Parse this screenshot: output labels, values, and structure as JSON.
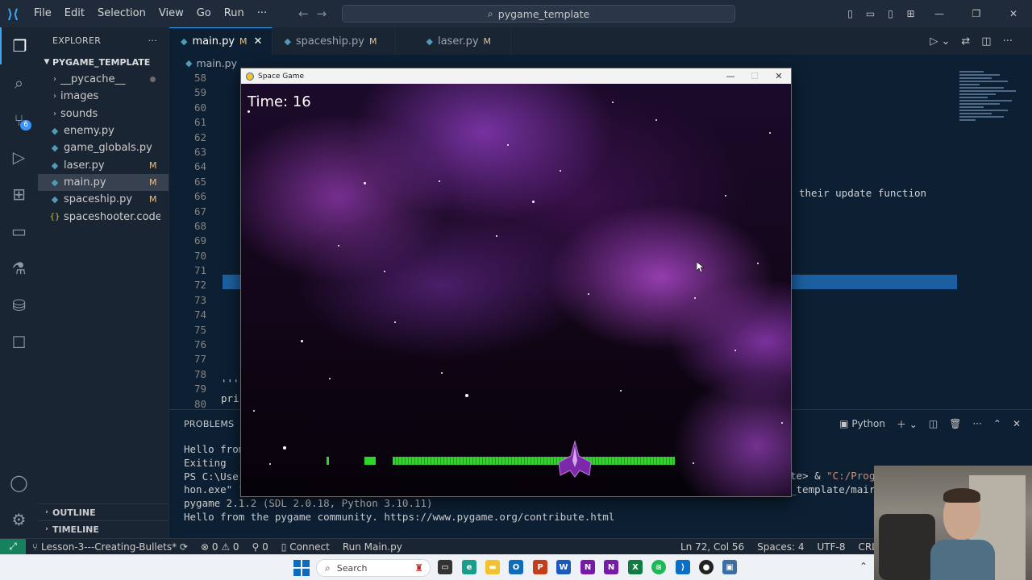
{
  "titlebar": {
    "menu": [
      "File",
      "Edit",
      "Selection",
      "View",
      "Go",
      "Run",
      "···"
    ],
    "search_text": "pygame_template"
  },
  "activity": {
    "scm_badge": "6"
  },
  "sidebar": {
    "header": "EXPLORER",
    "header_more": "···",
    "project": "PYGAME_TEMPLATE",
    "items": [
      {
        "label": "__pycache__",
        "type": "folder",
        "mod": ""
      },
      {
        "label": "images",
        "type": "folder",
        "mod": ""
      },
      {
        "label": "sounds",
        "type": "folder",
        "mod": ""
      },
      {
        "label": "enemy.py",
        "type": "python",
        "mod": ""
      },
      {
        "label": "game_globals.py",
        "type": "python",
        "mod": ""
      },
      {
        "label": "laser.py",
        "type": "python",
        "mod": "M"
      },
      {
        "label": "main.py",
        "type": "python",
        "mod": "M"
      },
      {
        "label": "spaceship.py",
        "type": "python",
        "mod": "M"
      },
      {
        "label": "spaceshooter.code-w...",
        "type": "json",
        "mod": ""
      }
    ],
    "outline": "OUTLINE",
    "timeline": "TIMELINE"
  },
  "tabs": [
    {
      "label": "main.py",
      "mod": "M",
      "active": true
    },
    {
      "label": "spaceship.py",
      "mod": "M",
      "active": false
    },
    {
      "label": "laser.py",
      "mod": "M",
      "active": false
    }
  ],
  "breadcrumb": "main.py",
  "editor": {
    "line_numbers": [
      "58",
      "59",
      "60",
      "61",
      "62",
      "63",
      "64",
      "65",
      "66",
      "67",
      "68",
      "69",
      "70",
      "71",
      "72",
      "73",
      "74",
      "75",
      "76",
      "77",
      "78",
      "79",
      "80"
    ],
    "comment_fragment": "their update function",
    "line79_fragment": "'''",
    "line80_fragment": "pri"
  },
  "panel": {
    "tab_problems": "PROBLEMS",
    "shell_label": "Python",
    "terminal_lines": [
      "Hello from",
      "Exiting",
      "PS C:\\User",
      "hon.exe\" \"",
      "pygame 2.1.2 (SDL 2.0.18, Python 3.10.11)",
      "Hello from the pygame community. https://www.pygame.org/contribute.html"
    ],
    "terminal_right_1_plain": "te> & ",
    "terminal_right_1_quoted": "\"C:/Prog",
    "terminal_right_2": "_template/mair"
  },
  "status": {
    "branch": "Lesson-3---Creating-Bullets*",
    "errors": "0",
    "warnings": "0",
    "ports": "0",
    "connect": "Connect",
    "run": "Run Main.py",
    "position": "Ln 72, Col 56",
    "spaces": "Spaces: 4",
    "encoding": "UTF-8",
    "eol": "CRLF"
  },
  "taskbar": {
    "search_placeholder": "Search"
  },
  "game": {
    "title": "Space Game",
    "hud_label": "Time: 16",
    "health_bar_color": "#2fd62a"
  },
  "colors": {
    "accent": "#3ca5f0",
    "editor_bg": "#0c1f33",
    "modified": "#e2c08d",
    "remote": "#16825d"
  }
}
